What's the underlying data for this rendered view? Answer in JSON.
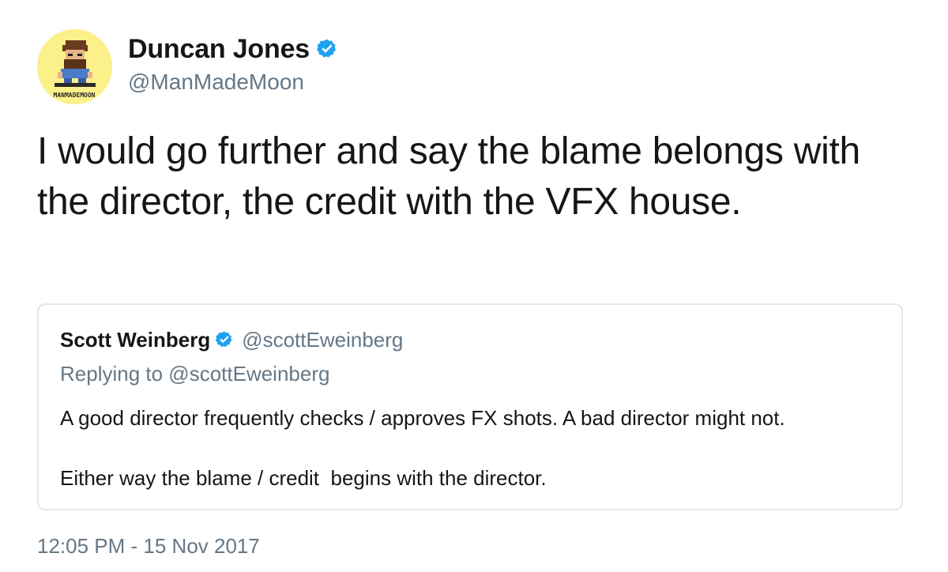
{
  "tweet": {
    "author": {
      "display_name": "Duncan Jones",
      "handle": "@ManMadeMoon",
      "verified": true,
      "avatar_icon": "pixel-art-avatar-icon",
      "avatar_caption": "MANMADEMOON"
    },
    "text": "I would go further and say the blame belongs with the director, the credit with the VFX house.",
    "timestamp": "12:05 PM - 15 Nov 2017"
  },
  "quoted_tweet": {
    "display_name": "Scott Weinberg",
    "handle": "@scottEweinberg",
    "verified": true,
    "replying_to": "Replying to @scottEweinberg",
    "line1": "A good director frequently checks / approves FX shots. A bad director might not.",
    "line2": "Either way the blame / credit  begins with the director."
  },
  "colors": {
    "text_primary": "#14171a",
    "text_secondary": "#657786",
    "verified_blue": "#1da1f2",
    "border": "#e1e8ed",
    "avatar_bg": "#fbf08a"
  }
}
